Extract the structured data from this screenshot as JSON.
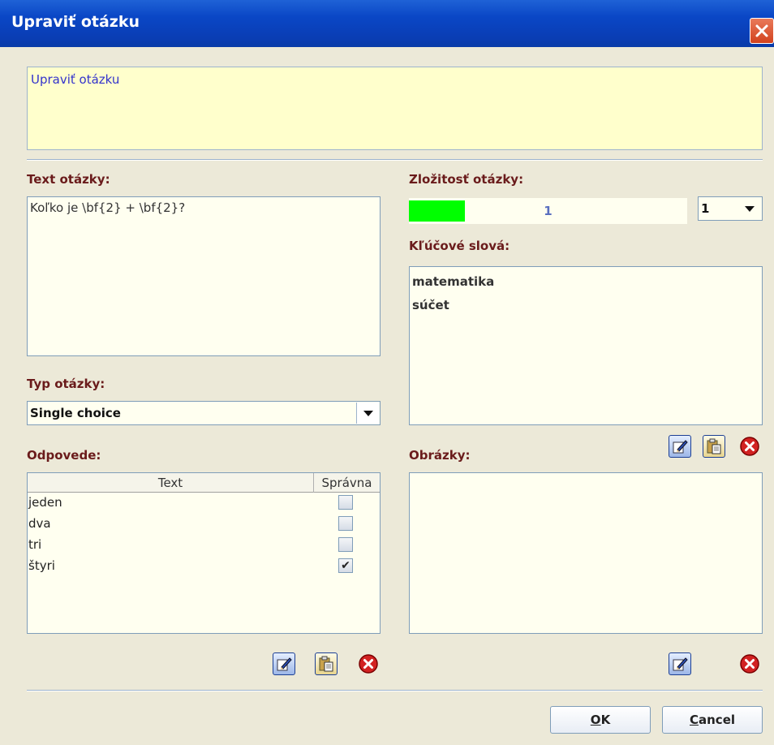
{
  "window": {
    "title": "Upraviť otázku"
  },
  "info": {
    "text": "Upraviť otázku"
  },
  "question": {
    "text_label": "Text otázky:",
    "text_value": "Koľko je \\bf{2} + \\bf{2}?",
    "type_label": "Typ otázky:",
    "type_value": "Single choice"
  },
  "difficulty": {
    "label": "Zložitosť otázky:",
    "value": 1,
    "value_text": "1",
    "fill_fraction": 0.2,
    "fill_color": "#00FF00",
    "combo_value": "1"
  },
  "keywords": {
    "label": "Kľúčové slová:",
    "items": [
      "matematika",
      "súčet"
    ]
  },
  "answers": {
    "label": "Odpovede:",
    "columns": [
      "Text",
      "Správna"
    ],
    "rows": [
      {
        "text": "jeden",
        "correct": false
      },
      {
        "text": "dva",
        "correct": false
      },
      {
        "text": "tri",
        "correct": false
      },
      {
        "text": "štyri",
        "correct": true
      }
    ]
  },
  "images": {
    "label": "Obrázky:"
  },
  "icons": {
    "edit": "edit-icon",
    "paste": "paste-icon",
    "delete": "delete-icon",
    "close": "close-icon"
  },
  "buttons": {
    "ok_mnemonic": "O",
    "ok_rest": "K",
    "cancel_mnemonic": "C",
    "cancel_rest": "ancel"
  }
}
